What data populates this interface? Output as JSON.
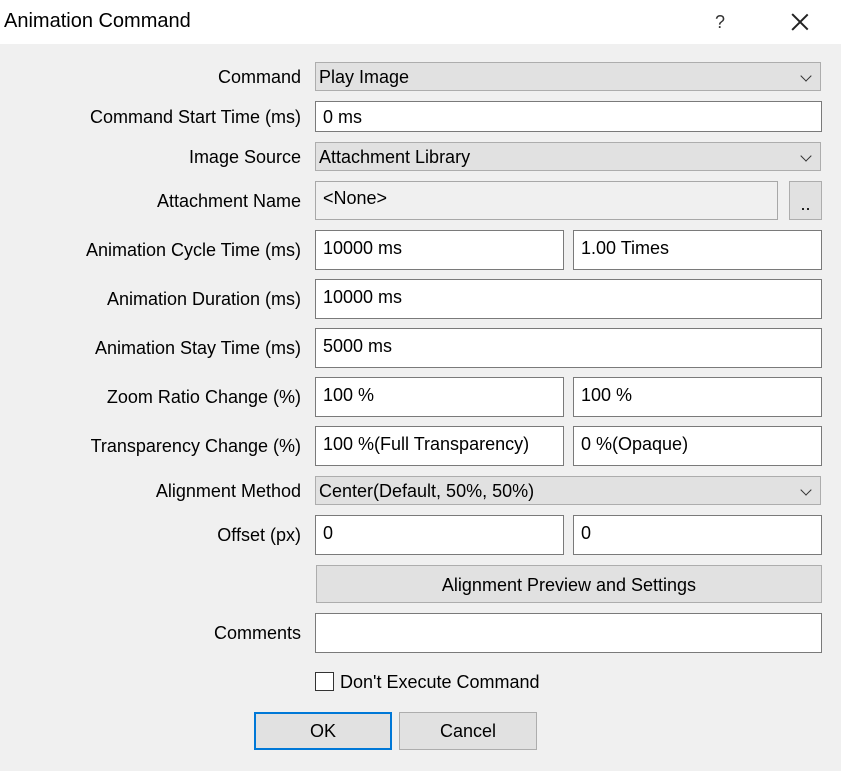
{
  "window": {
    "title": "Animation Command",
    "help_label": "?"
  },
  "form": {
    "command": {
      "label": "Command",
      "value": "Play Image"
    },
    "start_time": {
      "label": "Command Start Time (ms)",
      "value": "0 ms"
    },
    "image_source": {
      "label": "Image Source",
      "value": "Attachment Library"
    },
    "attachment": {
      "label": "Attachment Name",
      "value": "<None>",
      "browse_label": ".."
    },
    "cycle": {
      "label": "Animation Cycle Time (ms)",
      "value1": "10000 ms",
      "value2": "1.00 Times"
    },
    "duration": {
      "label": "Animation Duration (ms)",
      "value": "10000 ms"
    },
    "stay": {
      "label": "Animation Stay Time (ms)",
      "value": "5000 ms"
    },
    "zoom": {
      "label": "Zoom Ratio Change (%)",
      "value1": "100 %",
      "value2": "100 %"
    },
    "transparency": {
      "label": "Transparency Change (%)",
      "value1": "100 %(Full Transparency)",
      "value2": "0 %(Opaque)"
    },
    "alignment": {
      "label": "Alignment Method",
      "value": "Center(Default, 50%, 50%)"
    },
    "offset": {
      "label": "Offset (px)",
      "value1": "0",
      "value2": "0"
    },
    "preview_button": "Alignment Preview and Settings",
    "comments": {
      "label": "Comments",
      "value": ""
    },
    "dont_execute": {
      "label": "Don't Execute Command",
      "checked": false
    }
  },
  "buttons": {
    "ok": "OK",
    "cancel": "Cancel"
  },
  "colors": {
    "accent": "#0078d7",
    "background": "#f0f0f0",
    "button": "#e1e1e1"
  }
}
